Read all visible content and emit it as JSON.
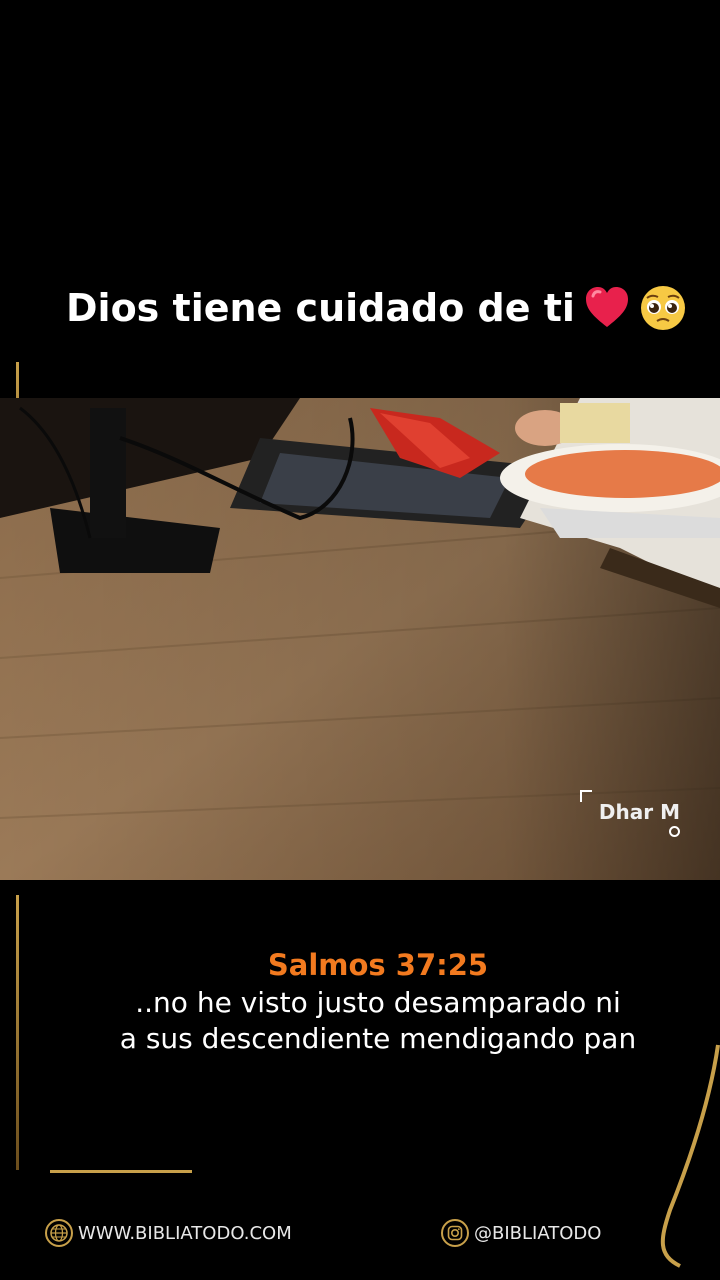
{
  "header": {
    "title": "Dios tiene cuidado de ti",
    "emojis": [
      "heart-emoji",
      "pleading-face-emoji"
    ]
  },
  "video": {
    "watermark": "Dhar M"
  },
  "verse": {
    "reference": "Salmos 37:25",
    "lines": [
      "..no he visto justo desamparado ni",
      "a sus descendiente mendigando pan"
    ]
  },
  "footer": {
    "website": "WWW.BIBLIATODO.COM",
    "instagram": "@BIBLIATODO"
  },
  "colors": {
    "background": "#000000",
    "accent_gold": "#c8a04a",
    "verse_reference": "#f27a1f",
    "text": "#ffffff"
  }
}
